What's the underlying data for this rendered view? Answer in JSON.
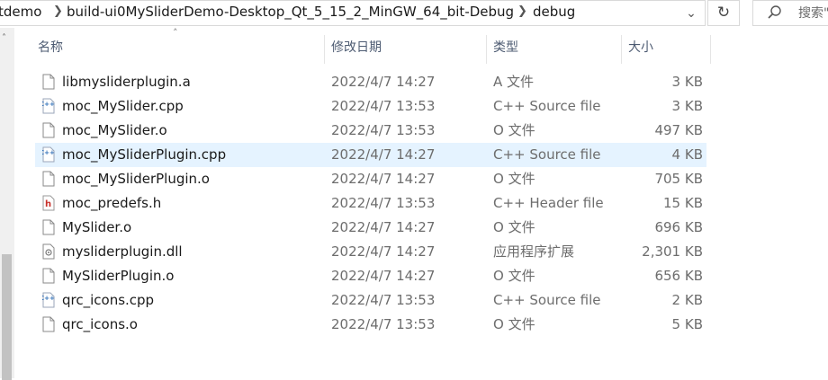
{
  "address_bar": {
    "crumbs": [
      "tdemo",
      "build-ui0MySliderDemo-Desktop_Qt_5_15_2_MinGW_64_bit-Debug",
      "debug"
    ],
    "dropdown_icon": "chevron-down-icon",
    "refresh_icon": "refresh-icon"
  },
  "search": {
    "placeholder": "搜索\"",
    "icon": "search-icon"
  },
  "columns": {
    "name": "名称",
    "date": "修改日期",
    "type": "类型",
    "size": "大小"
  },
  "files": [
    {
      "name": "libmysliderplugin.a",
      "date": "2022/4/7 14:27",
      "type": "A 文件",
      "size": "3 KB",
      "icon": "generic"
    },
    {
      "name": "moc_MySlider.cpp",
      "date": "2022/4/7 13:53",
      "type": "C++ Source file",
      "size": "3 KB",
      "icon": "cpp"
    },
    {
      "name": "moc_MySlider.o",
      "date": "2022/4/7 13:53",
      "type": "O 文件",
      "size": "497 KB",
      "icon": "generic"
    },
    {
      "name": "moc_MySliderPlugin.cpp",
      "date": "2022/4/7 14:27",
      "type": "C++ Source file",
      "size": "4 KB",
      "icon": "cpp",
      "selected": true
    },
    {
      "name": "moc_MySliderPlugin.o",
      "date": "2022/4/7 14:27",
      "type": "O 文件",
      "size": "705 KB",
      "icon": "generic"
    },
    {
      "name": "moc_predefs.h",
      "date": "2022/4/7 13:53",
      "type": "C++ Header file",
      "size": "15 KB",
      "icon": "header"
    },
    {
      "name": "MySlider.o",
      "date": "2022/4/7 14:27",
      "type": "O 文件",
      "size": "696 KB",
      "icon": "generic"
    },
    {
      "name": "mysliderplugin.dll",
      "date": "2022/4/7 14:27",
      "type": "应用程序扩展",
      "size": "2,301 KB",
      "icon": "dll"
    },
    {
      "name": "MySliderPlugin.o",
      "date": "2022/4/7 14:27",
      "type": "O 文件",
      "size": "656 KB",
      "icon": "generic"
    },
    {
      "name": "qrc_icons.cpp",
      "date": "2022/4/7 13:53",
      "type": "C++ Source file",
      "size": "2 KB",
      "icon": "cpp"
    },
    {
      "name": "qrc_icons.o",
      "date": "2022/4/7 13:53",
      "type": "O 文件",
      "size": "5 KB",
      "icon": "generic"
    }
  ],
  "colors": {
    "selected_row": "#e5f3ff",
    "header_text": "#4d5b72",
    "cpp_icon": "#2f6fb8",
    "header_icon": "#c8312b"
  }
}
